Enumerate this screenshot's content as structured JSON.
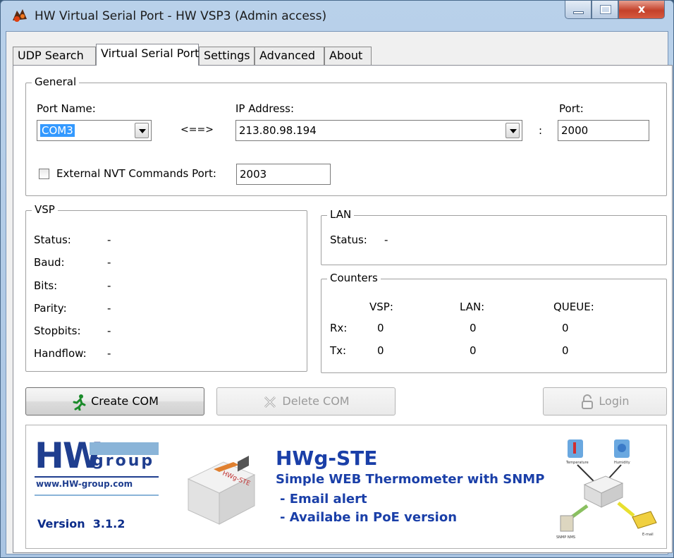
{
  "window": {
    "title": "HW Virtual Serial Port - HW VSP3 (Admin access)",
    "close_symbol": "x"
  },
  "tabs": [
    "UDP Search",
    "Virtual Serial Port",
    "Settings",
    "Advanced",
    "About"
  ],
  "general": {
    "title": "General",
    "port_name_label": "Port Name:",
    "port_name_value": "COM3",
    "arrow": "<==>",
    "ip_label": "IP Address:",
    "ip_value": "213.80.98.194",
    "colon": ":",
    "port_label": "Port:",
    "port_value": "2000",
    "nvt_label": "External NVT Commands Port:",
    "nvt_value": "2003"
  },
  "vsp": {
    "title": "VSP",
    "rows": [
      {
        "label": "Status:",
        "value": "-"
      },
      {
        "label": "Baud:",
        "value": "-"
      },
      {
        "label": "Bits:",
        "value": "-"
      },
      {
        "label": "Parity:",
        "value": "-"
      },
      {
        "label": "Stopbits:",
        "value": "-"
      },
      {
        "label": "Handflow:",
        "value": "-"
      }
    ]
  },
  "lan": {
    "title": "LAN",
    "status_label": "Status:",
    "status_value": "-"
  },
  "counters": {
    "title": "Counters",
    "columns": [
      "VSP:",
      "LAN:",
      "QUEUE:"
    ],
    "rows": [
      {
        "label": "Rx:",
        "values": [
          "0",
          "0",
          "0"
        ]
      },
      {
        "label": "Tx:",
        "values": [
          "0",
          "0",
          "0"
        ]
      }
    ]
  },
  "buttons": {
    "create": "Create COM",
    "delete": "Delete COM",
    "login": "Login"
  },
  "banner": {
    "logo_hw": "HW",
    "logo_group": "group",
    "website": "www.HW-group.com",
    "version": "Version  3.1.2",
    "product": "HWg-STE",
    "subtitle": "Simple WEB Thermometer with SNMP",
    "feature_1": "- Email alert",
    "feature_2": "- Availabe in PoE version",
    "device_label": "HWg-STE",
    "icon_temperature": "Temperature",
    "icon_humidity": "Humidity",
    "icon_snmp": "SNMP NMS",
    "icon_email": "E-mail"
  },
  "colors": {
    "banner_blue": "#1a3fa8",
    "version_blue": "#0b2c8a",
    "logo_dark": "#1f3e8f",
    "logo_light": "#8ab4d8"
  }
}
